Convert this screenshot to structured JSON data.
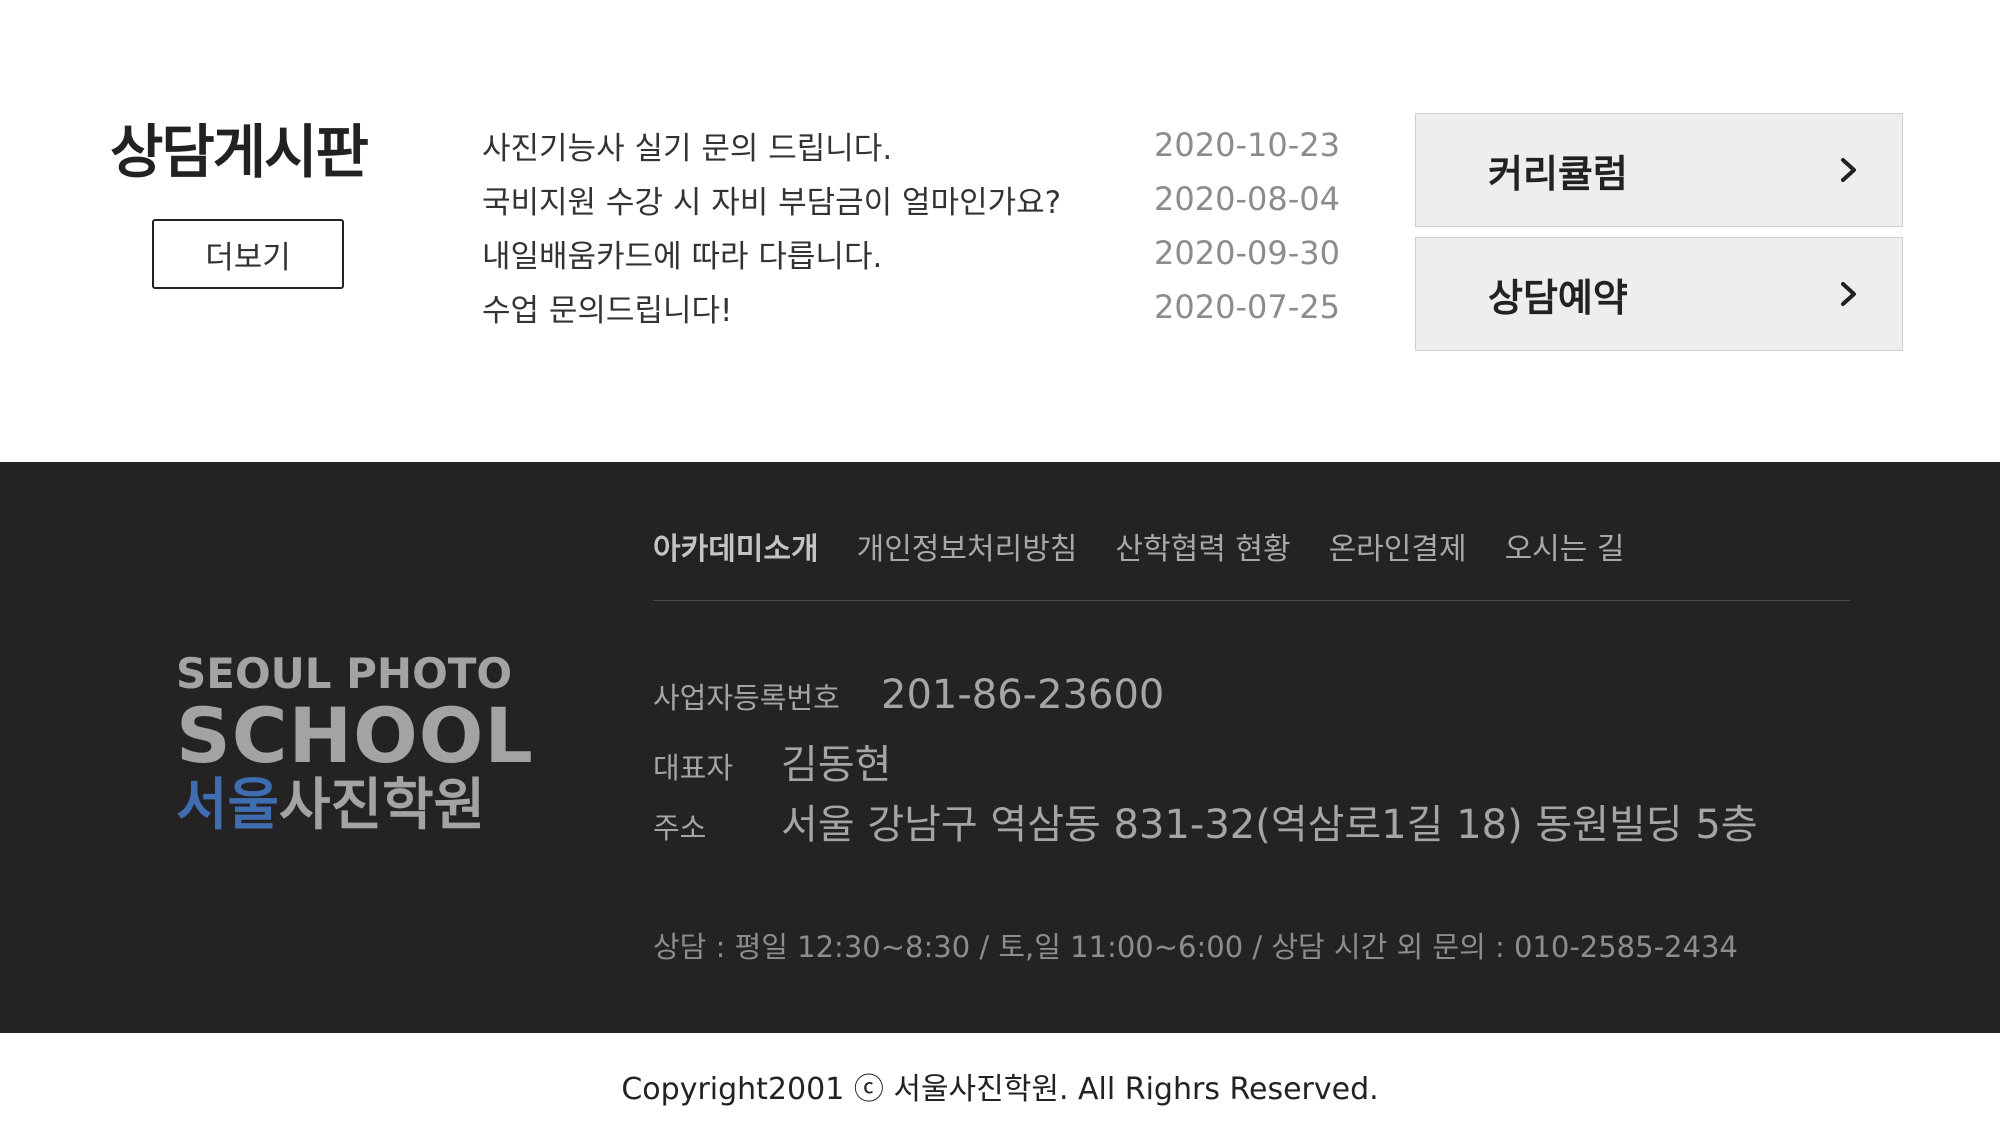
{
  "board": {
    "title": "상담게시판",
    "more_label": "더보기",
    "posts": [
      {
        "title": "사진기능사 실기 문의 드립니다.",
        "date": "2020-10-23"
      },
      {
        "title": "국비지원 수강 시 자비 부담금이 얼마인가요?",
        "date": "2020-08-04"
      },
      {
        "title": "내일배움카드에 따라 다릅니다.",
        "date": "2020-09-30"
      },
      {
        "title": "수업 문의드립니다!",
        "date": "2020-07-25"
      }
    ]
  },
  "quick_links": [
    {
      "label": "커리큘럼",
      "icon": "chevron-right-icon"
    },
    {
      "label": "상담예약",
      "icon": "chevron-right-icon"
    }
  ],
  "footer": {
    "logo": {
      "line1": "SEOUL PHOTO",
      "line2": "SCHOOL",
      "line3_accent": "서울",
      "line3_rest": "사진학원"
    },
    "nav": [
      "아카데미소개",
      "개인정보처리방침",
      "산학협력 현황",
      "온라인결제",
      "오시는 길"
    ],
    "info": {
      "biz_label": "사업자등록번호",
      "biz_value": "201-86-23600",
      "ceo_label": "대표자",
      "ceo_value": "김동현",
      "addr_label": "주소",
      "addr_value": "서울 강남구 역삼동 831-32(역삼로1길 18) 동원빌딩 5층"
    },
    "hours": "상담 : 평일 12:30~8:30 / 토,일 11:00~6:00 / 상담 시간 외 문의 : 010-2585-2434"
  },
  "copyright": "Copyright2001 ⓒ 서울사진학원. All Righrs Reserved.",
  "colors": {
    "footer_bg": "#252223",
    "logo_accent": "#3f6db1",
    "button_bg": "#eeeeee"
  }
}
